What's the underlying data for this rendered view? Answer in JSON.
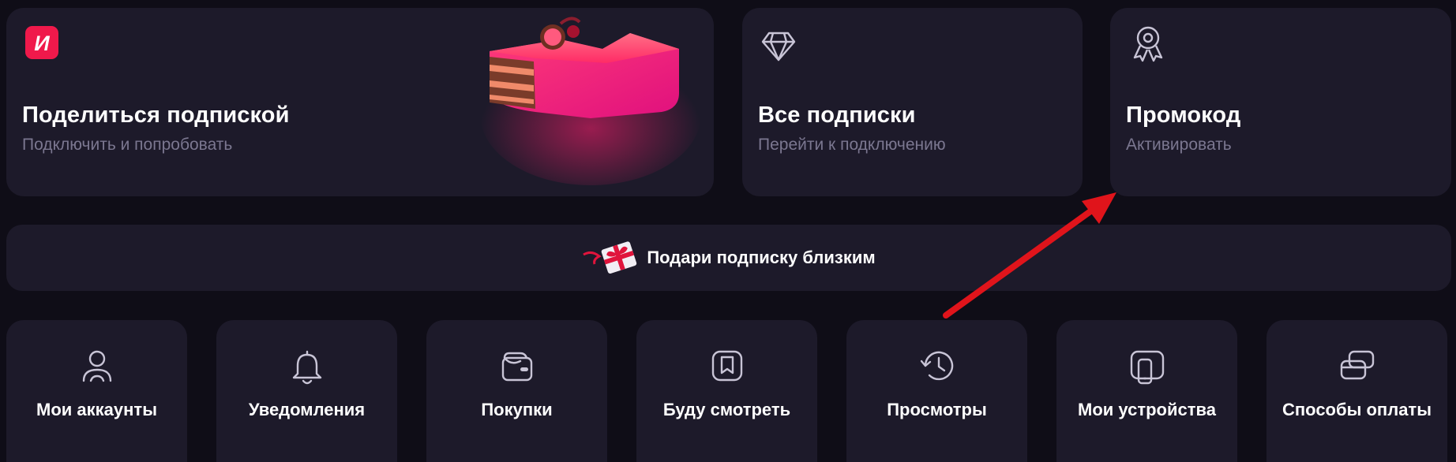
{
  "top_cards": {
    "share": {
      "title": "Поделиться подпиской",
      "subtitle": "Подключить и попробовать",
      "logo_letter": "И"
    },
    "all": {
      "title": "Все подписки",
      "subtitle": "Перейти к подключению"
    },
    "promo": {
      "title": "Промокод",
      "subtitle": "Активировать"
    }
  },
  "gift_banner": {
    "label": "Подари подписку близким"
  },
  "tiles": [
    {
      "label": "Мои аккаунты",
      "icon": "user-icon"
    },
    {
      "label": "Уведомления",
      "icon": "bell-icon"
    },
    {
      "label": "Покупки",
      "icon": "wallet-icon"
    },
    {
      "label": "Буду смотреть",
      "icon": "bookmark-icon"
    },
    {
      "label": "Просмотры",
      "icon": "history-icon"
    },
    {
      "label": "Мои устройства",
      "icon": "devices-icon"
    },
    {
      "label": "Способы оплаты",
      "icon": "cards-icon"
    }
  ],
  "colors": {
    "background": "#0f0d17",
    "card": "#1d1a2a",
    "subtitle": "#7b7790",
    "brand": "#f0194b",
    "annotation_arrow": "#e0141b"
  }
}
